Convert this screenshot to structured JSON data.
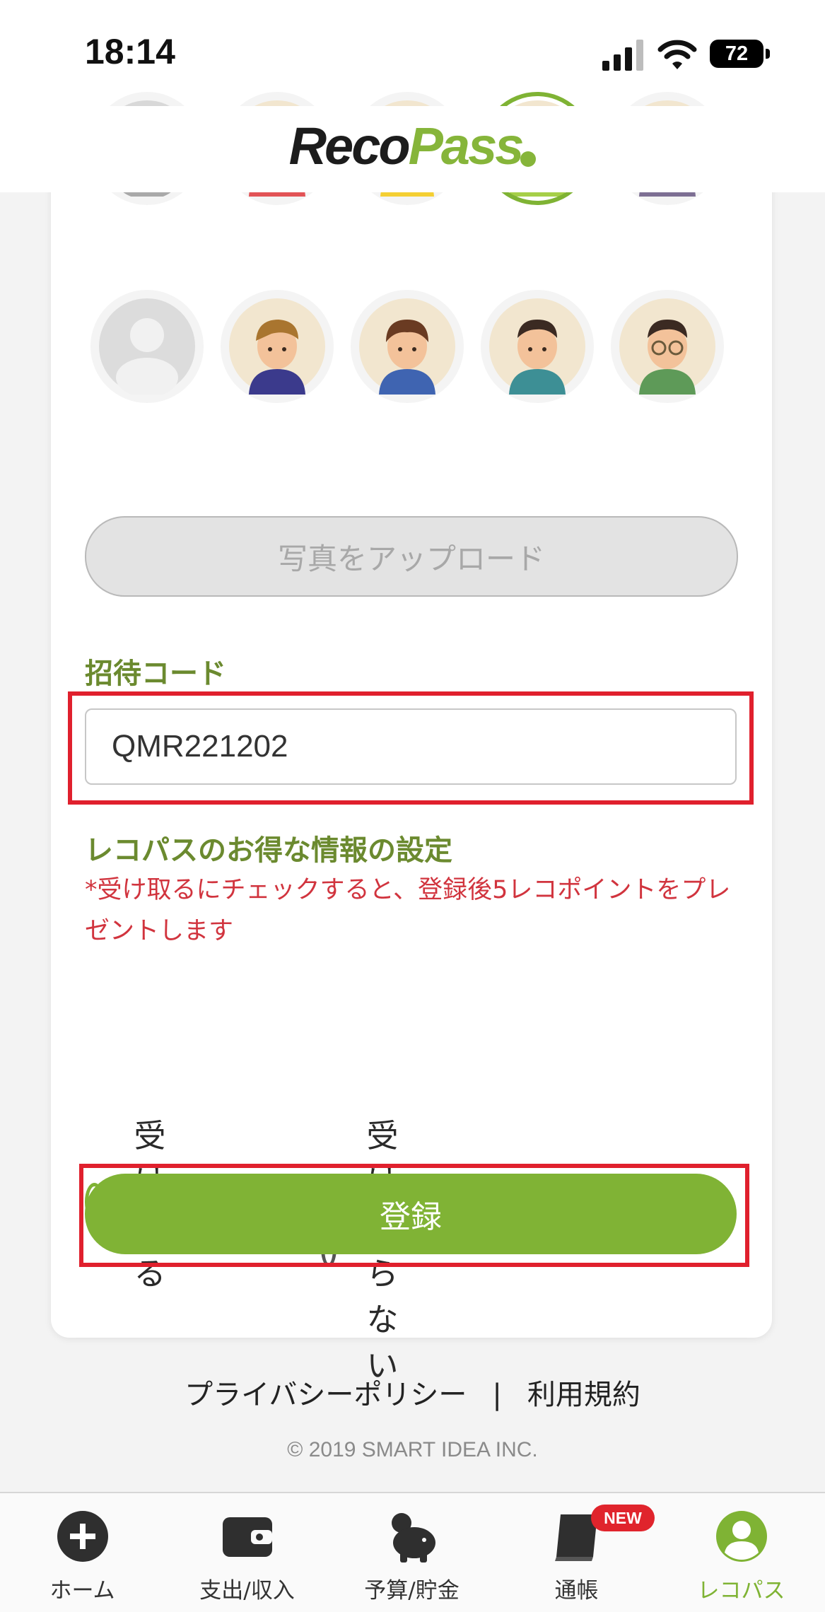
{
  "status_bar": {
    "time": "18:14",
    "battery": "72",
    "icons": [
      "cellular-signal-icon",
      "wifi-icon",
      "battery-icon"
    ]
  },
  "header": {
    "logo_part1": "Reco",
    "logo_part2": "Pass"
  },
  "avatars": {
    "selected_index": 3,
    "items": [
      {
        "name": "default-avatar-gray"
      },
      {
        "name": "girl-avatar-red-shirt"
      },
      {
        "name": "girl-avatar-yellow-shirt"
      },
      {
        "name": "woman-avatar-green-shirt"
      },
      {
        "name": "woman-avatar-glasses"
      },
      {
        "name": "default-avatar-light"
      },
      {
        "name": "boy-avatar-navy-shirt"
      },
      {
        "name": "boy-avatar-blue-shirt"
      },
      {
        "name": "man-avatar-teal-shirt"
      },
      {
        "name": "man-avatar-glasses"
      }
    ]
  },
  "form": {
    "upload_label": "写真をアップロード",
    "invite_code_label": "招待コード",
    "invite_code_value": "QMR221202",
    "promo_title": "レコパスのお得な情報の設定",
    "promo_note": "*受け取るにチェックすると、登録後5レコポイントをプレゼントします",
    "options": [
      {
        "label": "受け取る",
        "checked": true
      },
      {
        "label": "受け取らない",
        "checked": false
      }
    ],
    "register_label": "登録"
  },
  "footer": {
    "privacy": "プライバシーポリシー",
    "separator": "|",
    "terms": "利用規約",
    "copyright": "© 2019 SMART IDEA INC."
  },
  "tabbar": {
    "badge": "NEW",
    "tabs": [
      {
        "label": "ホーム",
        "icon": "plus-circle-icon"
      },
      {
        "label": "支出/収入",
        "icon": "wallet-icon"
      },
      {
        "label": "予算/貯金",
        "icon": "piggy-bank-icon"
      },
      {
        "label": "通帳",
        "icon": "passbook-icon"
      },
      {
        "label": "レコパス",
        "icon": "user-circle-icon",
        "active": true
      }
    ]
  },
  "colors": {
    "brand_green": "#80b335",
    "label_green": "#6b8a2f",
    "alert_red": "#d1343e",
    "highlight_red": "#e0202d"
  }
}
